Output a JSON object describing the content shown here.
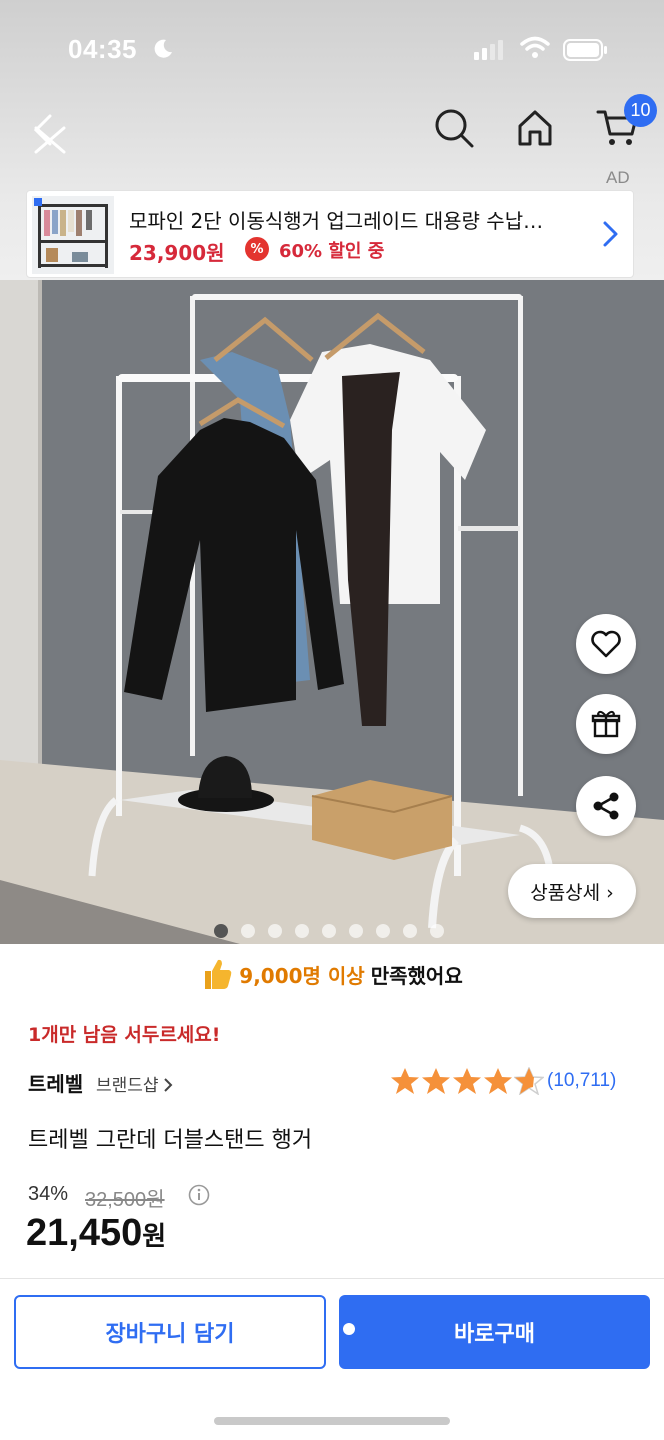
{
  "status_bar": {
    "time": "04:35"
  },
  "header": {
    "cart_count": "10",
    "ad_label": "AD"
  },
  "ad_banner": {
    "title": "모파인 2단 이동식행거 업그레이드 대용량 수납…",
    "price": "23,900원",
    "discount_icon": "%",
    "discount_text": "60% 할인 중"
  },
  "gallery": {
    "detail_button": "상품상세 ›",
    "dots_total": 9,
    "active_index": 0
  },
  "satisfaction": {
    "highlight": "9,000명 이상",
    "rest": "만족했어요"
  },
  "product": {
    "urgent": "1개만 남음 서두르세요!",
    "brand": "트레벨",
    "brand_shop": "브랜드샵",
    "rating": 4.5,
    "review_count": "(10,711)",
    "title": "트레벨 그란데 더블스탠드 행거",
    "discount_rate": "34%",
    "original_price": "32,500원",
    "price": "21,450",
    "price_unit": "원"
  },
  "actions": {
    "add_to_cart": "장바구니 담기",
    "buy_now": "바로구매"
  },
  "colors": {
    "accent": "#2f6df2",
    "sale_red": "#d6293a",
    "satisfy_orange": "#e07a00",
    "star": "#f5913a"
  },
  "icons": [
    "back-icon",
    "close-icon",
    "search-icon",
    "home-icon",
    "cart-icon",
    "chevron-right-icon",
    "heart-icon",
    "gift-icon",
    "share-icon",
    "thumbs-up-icon",
    "star-icon",
    "info-icon"
  ]
}
